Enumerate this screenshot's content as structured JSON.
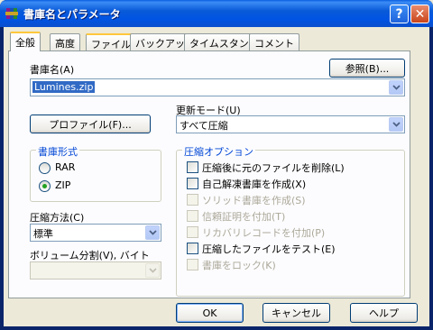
{
  "window": {
    "title": "書庫名とパラメータ",
    "help_glyph": "?",
    "close_glyph": "✕"
  },
  "tabs": [
    {
      "label": "全般",
      "active": true
    },
    {
      "label": "高度"
    },
    {
      "label": "ファイル"
    },
    {
      "label": "バックアップ"
    },
    {
      "label": "タイムスタンプ"
    },
    {
      "label": "コメント"
    }
  ],
  "archive": {
    "label": "書庫名(A)",
    "value": "Lumines.zip",
    "browse_button": "参照(B)..."
  },
  "profile_button": "プロファイル(F)...",
  "update_mode": {
    "label": "更新モード(U)",
    "value": "すべて圧縮"
  },
  "format_group": {
    "title": "書庫形式",
    "options": [
      {
        "label": "RAR",
        "checked": false
      },
      {
        "label": "ZIP",
        "checked": true
      }
    ]
  },
  "compression": {
    "label": "圧縮方法(C)",
    "value": "標準"
  },
  "volume": {
    "label": "ボリューム分割(V), バイト",
    "value": ""
  },
  "options_group": {
    "title": "圧縮オプション",
    "items": [
      {
        "label": "圧縮後に元のファイルを削除(L)",
        "checked": false,
        "enabled": true
      },
      {
        "label": "自己解凍書庫を作成(X)",
        "checked": false,
        "enabled": true
      },
      {
        "label": "ソリッド書庫を作成(S)",
        "checked": false,
        "enabled": false
      },
      {
        "label": "信頼証明を付加(T)",
        "checked": false,
        "enabled": false
      },
      {
        "label": "リカバリレコードを付加(P)",
        "checked": false,
        "enabled": false
      },
      {
        "label": "圧縮したファイルをテスト(E)",
        "checked": false,
        "enabled": true
      },
      {
        "label": "書庫をロック(K)",
        "checked": false,
        "enabled": false
      }
    ]
  },
  "footer": {
    "ok": "OK",
    "cancel": "キャンセル",
    "help": "ヘルプ"
  },
  "icons": {
    "app": "winrar-books-icon",
    "dropdown": "chevron-down-icon"
  },
  "colors": {
    "titlebar": "#0054E3",
    "group_title": "#0046D5",
    "selection": "#316AC5",
    "tab_highlight": "#FFC83C"
  }
}
